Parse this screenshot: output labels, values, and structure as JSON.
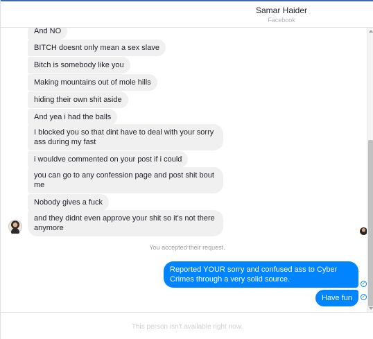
{
  "header": {
    "contact_name": "Samar Haider",
    "contact_source": "Facebook"
  },
  "thread": {
    "incoming_messages": [
      "And NO",
      "BITCH doesnt only mean a sex slave",
      "Bitch is somebody like you",
      "Making mountains out of mole hills",
      "hiding their own shit aside",
      "And yea i had the balls",
      "I blocked you so that dint have to deal with your sorry ass during my fast",
      "i wouldve commented on your post if i could",
      "you can go to any confession page and post shit bout me",
      "Nobody gives a fuck",
      "and they didnt even approve your shit so it's not there anymore"
    ],
    "system_note": "You accepted their request.",
    "outgoing_messages": [
      "Reported YOUR sorry and confused ass to Cyber Crimes through a very solid source.",
      "Have fun"
    ],
    "sent_indicator": "✓"
  },
  "composer": {
    "unavailable_text": "This person isn't available right now."
  },
  "colors": {
    "outgoing_bubble": "#0084ff",
    "incoming_bubble": "#f1f0f0",
    "accent": "#4267b2"
  }
}
